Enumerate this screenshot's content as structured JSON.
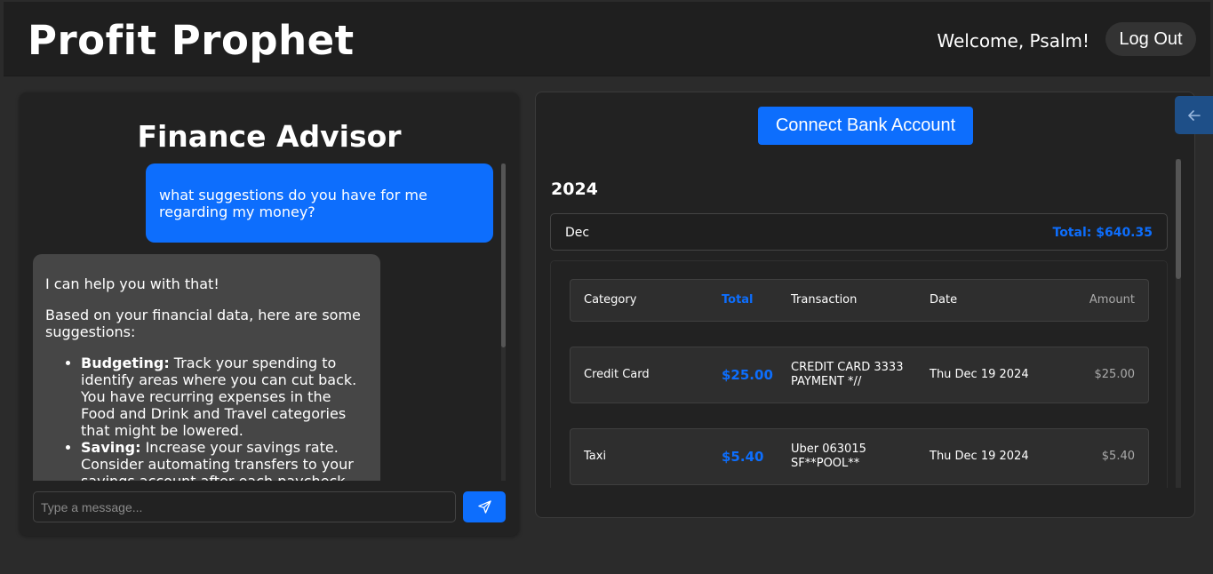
{
  "header": {
    "app_title": "Profit Prophet",
    "welcome_text": "Welcome, Psalm!",
    "logout_label": "Log Out"
  },
  "chat": {
    "title": "Finance Advisor",
    "messages": [
      {
        "role": "user",
        "text": "what suggestions do you have for me regarding my money?"
      },
      {
        "role": "bot",
        "intro": "I can help you with that!",
        "lead": "Based on your financial data, here are some suggestions:",
        "items": [
          {
            "bold": "Budgeting:",
            "text": " Track your spending to identify areas where you can cut back. You have recurring expenses in the Food and Drink and Travel categories that might be lowered."
          },
          {
            "bold": "Saving:",
            "text": " Increase your savings rate. Consider automating transfers to your savings account after each paycheck."
          }
        ]
      }
    ],
    "input_placeholder": "Type a message...",
    "send_icon": "send-icon"
  },
  "bank": {
    "connect_label": "Connect Bank Account",
    "year": "2024",
    "month": {
      "name": "Dec",
      "total": "Total: $640.35"
    },
    "table": {
      "headers": {
        "category": "Category",
        "total": "Total",
        "transaction": "Transaction",
        "date": "Date",
        "amount": "Amount"
      },
      "rows": [
        {
          "category": "Credit Card",
          "total": "$25.00",
          "transaction": "CREDIT CARD 3333 PAYMENT *//",
          "date": "Thu Dec 19 2024",
          "amount": "$25.00"
        },
        {
          "category": "Taxi",
          "total": "$5.40",
          "transaction": "Uber 063015 SF**POOL**",
          "date": "Thu Dec 19 2024",
          "amount": "$5.40"
        }
      ]
    }
  },
  "collapse_icon": "arrow-left-icon",
  "colors": {
    "accent": "#0d6efd",
    "background": "#2b2b2b",
    "panel": "#222222",
    "bot_bubble": "#464646"
  }
}
